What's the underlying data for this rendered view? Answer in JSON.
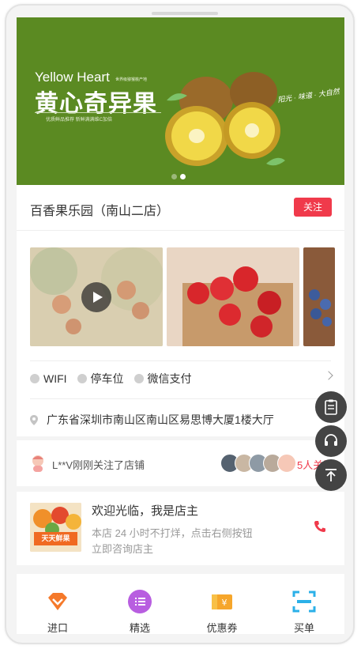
{
  "banner": {
    "title_en": "Yellow Heart",
    "title_small": "世界级猕猴桃产地",
    "title_cn": "黄心奇异果",
    "subtitle": "优质鲜品推荐 新鲜满满维C加倍",
    "script_text": "阳光 · 味道 · 大自然"
  },
  "store": {
    "name": "百香果乐园（南山二店）",
    "follow_label": "关注",
    "amenities": [
      "WIFI",
      "停车位",
      "微信支付"
    ],
    "address": "广东省深圳市南山区南山区易思博大厦1楼大厅"
  },
  "fans": {
    "text": "L**V刚刚关注了店铺",
    "count": "5人关注"
  },
  "owner": {
    "title": "欢迎光临，我是店主",
    "desc": "本店 24 小时不打烊，点击右侧按钮立即咨询店主",
    "image_tag": "天天鲜果"
  },
  "nav": [
    {
      "label": "进口",
      "icon": "diamond-chevron-icon"
    },
    {
      "label": "精选",
      "icon": "list-icon"
    },
    {
      "label": "优惠券",
      "icon": "coupon-icon"
    },
    {
      "label": "买单",
      "icon": "scan-icon"
    }
  ],
  "colors": {
    "accent": "#f03a4b",
    "banner_green": "#5b8a22",
    "fab": "#444444"
  }
}
